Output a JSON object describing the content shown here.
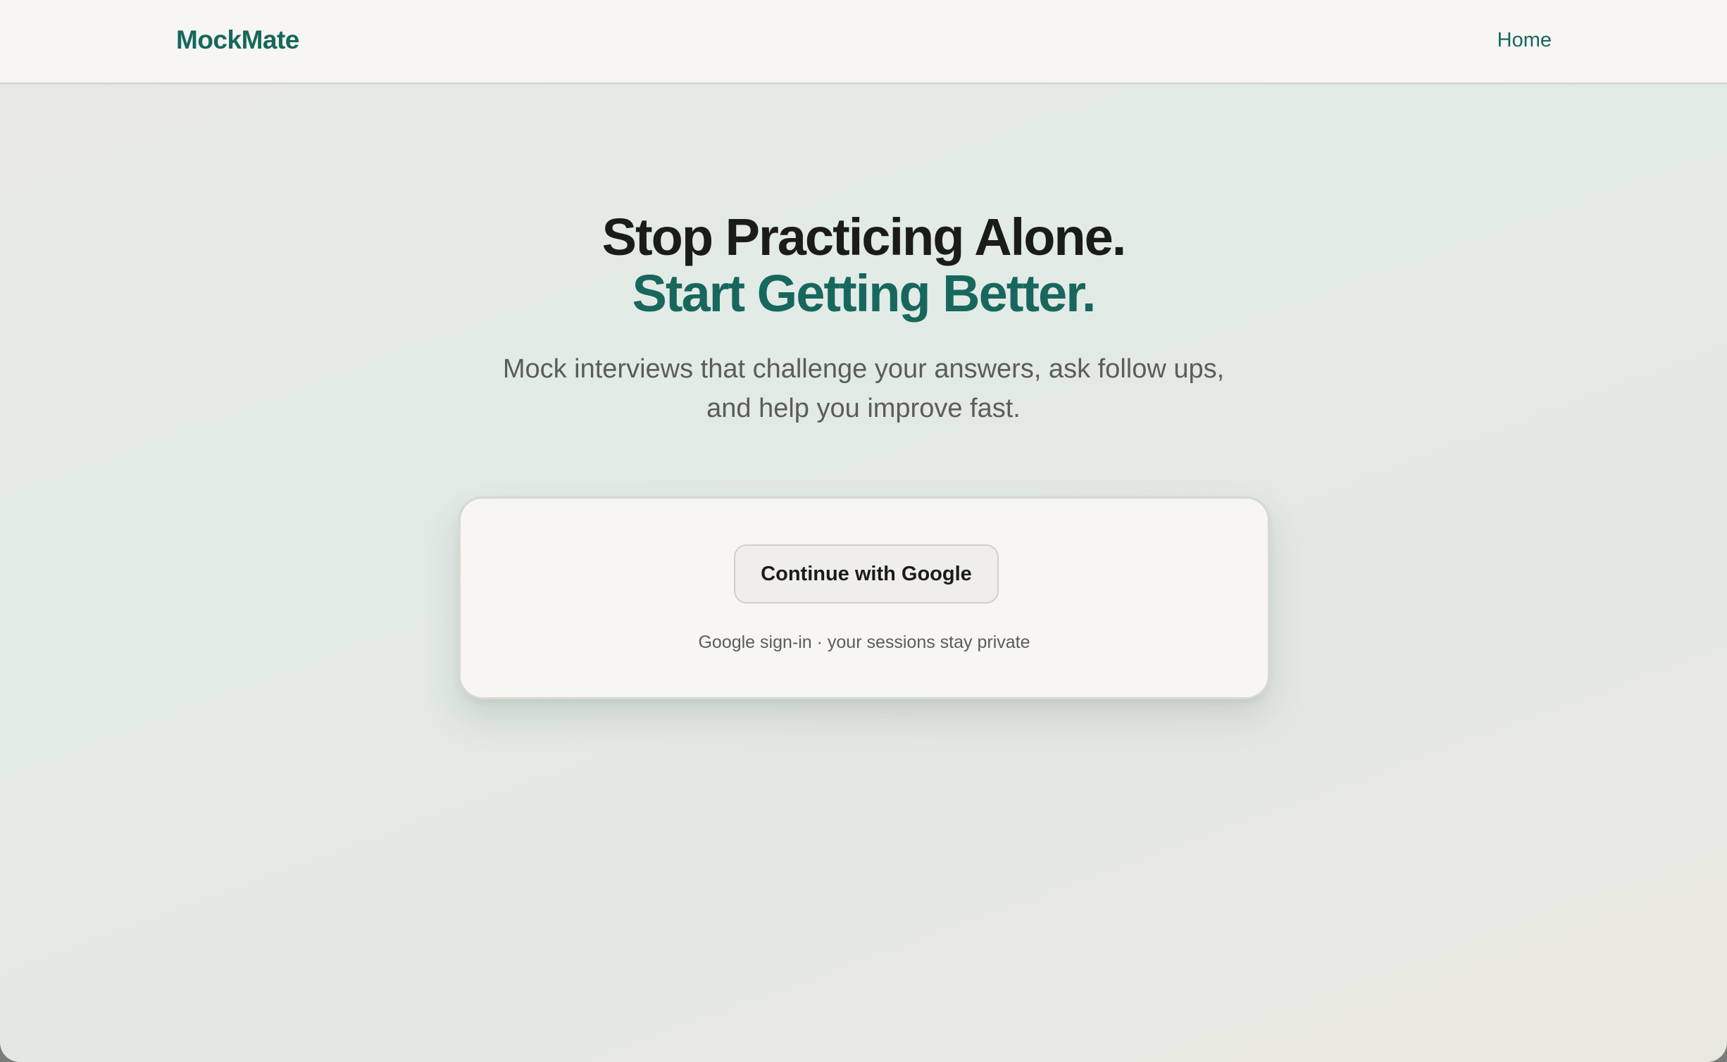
{
  "nav": {
    "brand": "MockMate",
    "home_link": "Home"
  },
  "hero": {
    "line1": "Stop Practicing Alone.",
    "line2": "Start Getting Better.",
    "subtitle_line1": "Mock interviews that challenge your answers, ask follow ups,",
    "subtitle_line2": "and help you improve fast."
  },
  "auth_card": {
    "button_label": "Continue with Google",
    "note": "Google sign-in · your sessions stay private"
  },
  "colors": {
    "accent": "#17675d",
    "text_primary": "#1b1c1a",
    "text_secondary": "#5a5d58",
    "card_background": "#f7f6f2"
  }
}
